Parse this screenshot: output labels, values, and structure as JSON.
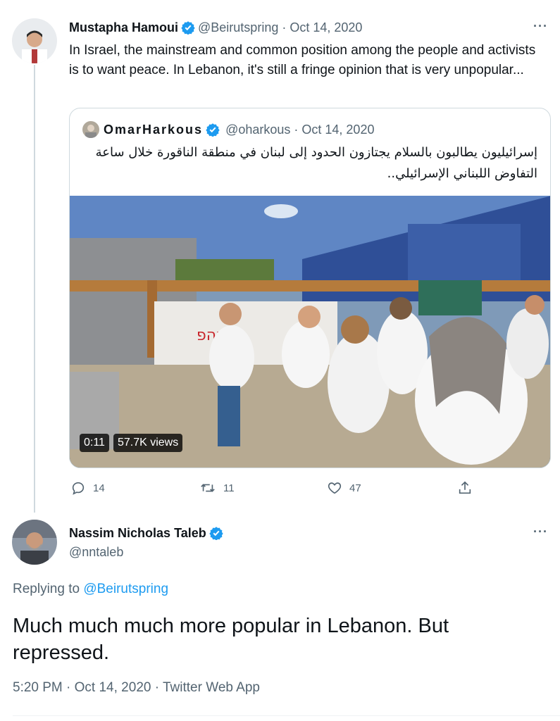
{
  "first_tweet": {
    "display_name": "Mustapha Hamoui",
    "handle": "@Beirutspring",
    "date": "Oct 14, 2020",
    "text": "In Israel, the mainstream and common position among the people and activists is to want peace. In Lebanon, it's still a fringe opinion that is very unpopular...",
    "more_label": "···",
    "quote": {
      "display_name": "OmarHarkous",
      "handle": "@oharkous",
      "date": "Oct 14, 2020",
      "text": "إسرائيليون يطالبون بالسلام يجتازون الحدود إلى لبنان في منطقة الناقورة خلال ساعة التفاوض اللبناني الإسرائيلي..",
      "video_time": "0:11",
      "video_views": "57.7K views"
    },
    "actions": {
      "reply_count": "14",
      "retweet_count": "11",
      "like_count": "47"
    }
  },
  "main_tweet": {
    "display_name": "Nassim Nicholas Taleb",
    "handle": "@nntaleb",
    "more_label": "···",
    "replying_label": "Replying to",
    "replying_handle": "@Beirutspring",
    "text": "Much much much more popular in Lebanon. But repressed.",
    "timestamp": "5:20 PM",
    "date": "Oct 14, 2020",
    "source": "Twitter Web App"
  },
  "separator": "·",
  "icons": {
    "verified": "verified-badge-icon",
    "reply": "reply-icon",
    "retweet": "retweet-icon",
    "like": "heart-icon",
    "share": "share-icon"
  },
  "colors": {
    "accent": "#1d9bf0",
    "muted": "#536471",
    "text": "#0f1419",
    "border": "#cfd9de"
  }
}
